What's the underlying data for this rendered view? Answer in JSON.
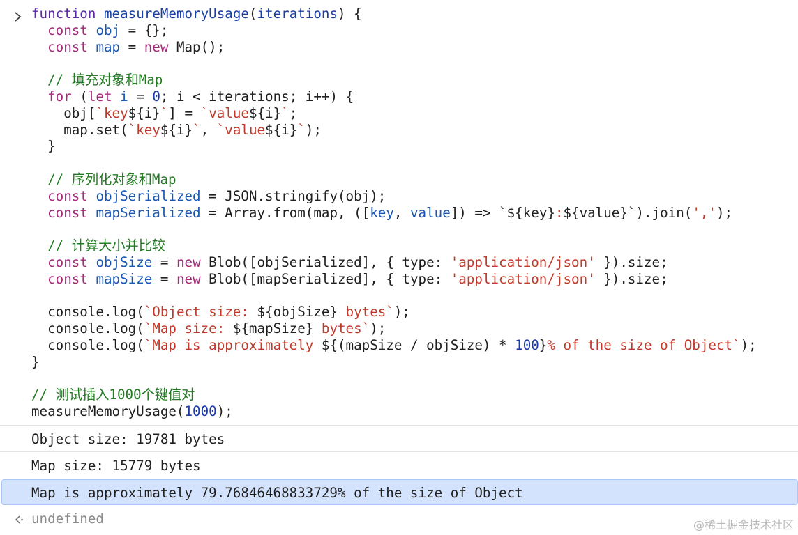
{
  "prompt_icon": "chevron-right-icon",
  "result_icon": "return-arrow-icon",
  "code_lines": [
    [
      {
        "t": "function",
        "c": "kwb"
      },
      {
        "t": " "
      },
      {
        "t": "measureMemoryUsage",
        "c": "fn"
      },
      {
        "t": "("
      },
      {
        "t": "iterations",
        "c": "fn"
      },
      {
        "t": ") {"
      }
    ],
    [
      {
        "t": "  "
      },
      {
        "t": "const",
        "c": "kw"
      },
      {
        "t": " "
      },
      {
        "t": "obj",
        "c": "var"
      },
      {
        "t": " = {};"
      }
    ],
    [
      {
        "t": "  "
      },
      {
        "t": "const",
        "c": "kw"
      },
      {
        "t": " "
      },
      {
        "t": "map",
        "c": "var"
      },
      {
        "t": " = "
      },
      {
        "t": "new",
        "c": "kw"
      },
      {
        "t": " Map();"
      }
    ],
    [],
    [
      {
        "t": "  "
      },
      {
        "t": "// 填充对象和Map",
        "c": "cm"
      }
    ],
    [
      {
        "t": "  "
      },
      {
        "t": "for",
        "c": "kw"
      },
      {
        "t": " ("
      },
      {
        "t": "let",
        "c": "kw"
      },
      {
        "t": " "
      },
      {
        "t": "i",
        "c": "var"
      },
      {
        "t": " = "
      },
      {
        "t": "0",
        "c": "num"
      },
      {
        "t": "; i < iterations; i++) {"
      }
    ],
    [
      {
        "t": "    obj["
      },
      {
        "t": "`key",
        "c": "str"
      },
      {
        "t": "${i}"
      },
      {
        "t": "`",
        "c": "str"
      },
      {
        "t": "] = "
      },
      {
        "t": "`value",
        "c": "str"
      },
      {
        "t": "${i}"
      },
      {
        "t": "`",
        "c": "str"
      },
      {
        "t": ";"
      }
    ],
    [
      {
        "t": "    map.set("
      },
      {
        "t": "`key",
        "c": "str"
      },
      {
        "t": "${i}"
      },
      {
        "t": "`",
        "c": "str"
      },
      {
        "t": ", "
      },
      {
        "t": "`value",
        "c": "str"
      },
      {
        "t": "${i}"
      },
      {
        "t": "`",
        "c": "str"
      },
      {
        "t": ");"
      }
    ],
    [
      {
        "t": "  }"
      }
    ],
    [],
    [
      {
        "t": "  "
      },
      {
        "t": "// 序列化对象和Map",
        "c": "cm"
      }
    ],
    [
      {
        "t": "  "
      },
      {
        "t": "const",
        "c": "kw"
      },
      {
        "t": " "
      },
      {
        "t": "objSerialized",
        "c": "var"
      },
      {
        "t": " = JSON.stringify(obj);"
      }
    ],
    [
      {
        "t": "  "
      },
      {
        "t": "const",
        "c": "kw"
      },
      {
        "t": " "
      },
      {
        "t": "mapSerialized",
        "c": "var"
      },
      {
        "t": " = Array.from(map, (["
      },
      {
        "t": "key",
        "c": "var"
      },
      {
        "t": ", "
      },
      {
        "t": "value",
        "c": "var"
      },
      {
        "t": "]) => `${key}"
      },
      {
        "t": ":",
        "c": "str"
      },
      {
        "t": "${value}`).join("
      },
      {
        "t": "','",
        "c": "str"
      },
      {
        "t": ");"
      }
    ],
    [],
    [
      {
        "t": "  "
      },
      {
        "t": "// 计算大小并比较",
        "c": "cm"
      }
    ],
    [
      {
        "t": "  "
      },
      {
        "t": "const",
        "c": "kw"
      },
      {
        "t": " "
      },
      {
        "t": "objSize",
        "c": "var"
      },
      {
        "t": " = "
      },
      {
        "t": "new",
        "c": "kw"
      },
      {
        "t": " Blob([objSerialized], { type: "
      },
      {
        "t": "'application/json'",
        "c": "str"
      },
      {
        "t": " }).size;"
      }
    ],
    [
      {
        "t": "  "
      },
      {
        "t": "const",
        "c": "kw"
      },
      {
        "t": " "
      },
      {
        "t": "mapSize",
        "c": "var"
      },
      {
        "t": " = "
      },
      {
        "t": "new",
        "c": "kw"
      },
      {
        "t": " Blob([mapSerialized], { type: "
      },
      {
        "t": "'application/json'",
        "c": "str"
      },
      {
        "t": " }).size;"
      }
    ],
    [],
    [
      {
        "t": "  console.log("
      },
      {
        "t": "`Object size: ",
        "c": "str"
      },
      {
        "t": "${objSize}"
      },
      {
        "t": " bytes`",
        "c": "str"
      },
      {
        "t": ");"
      }
    ],
    [
      {
        "t": "  console.log("
      },
      {
        "t": "`Map size: ",
        "c": "str"
      },
      {
        "t": "${mapSize}"
      },
      {
        "t": " bytes`",
        "c": "str"
      },
      {
        "t": ");"
      }
    ],
    [
      {
        "t": "  console.log("
      },
      {
        "t": "`Map is approximately ",
        "c": "str"
      },
      {
        "t": "${(mapSize / objSize) * "
      },
      {
        "t": "100",
        "c": "num"
      },
      {
        "t": "}"
      },
      {
        "t": "% of the size of Object`",
        "c": "str"
      },
      {
        "t": ");"
      }
    ],
    [
      {
        "t": "}"
      }
    ],
    [],
    [
      {
        "t": "// 测试插入1000个键值对",
        "c": "cm"
      }
    ],
    [
      {
        "t": "measureMemoryUsage("
      },
      {
        "t": "1000",
        "c": "num"
      },
      {
        "t": ");"
      }
    ]
  ],
  "outputs": [
    {
      "text": "Object size: 19781 bytes",
      "highlight": false
    },
    {
      "text": "Map size: 15779 bytes",
      "highlight": false
    },
    {
      "text": "Map is approximately 79.76846468833729% of the size of Object",
      "highlight": true
    }
  ],
  "result": {
    "text": "undefined"
  },
  "watermark": "@稀土掘金技术社区"
}
